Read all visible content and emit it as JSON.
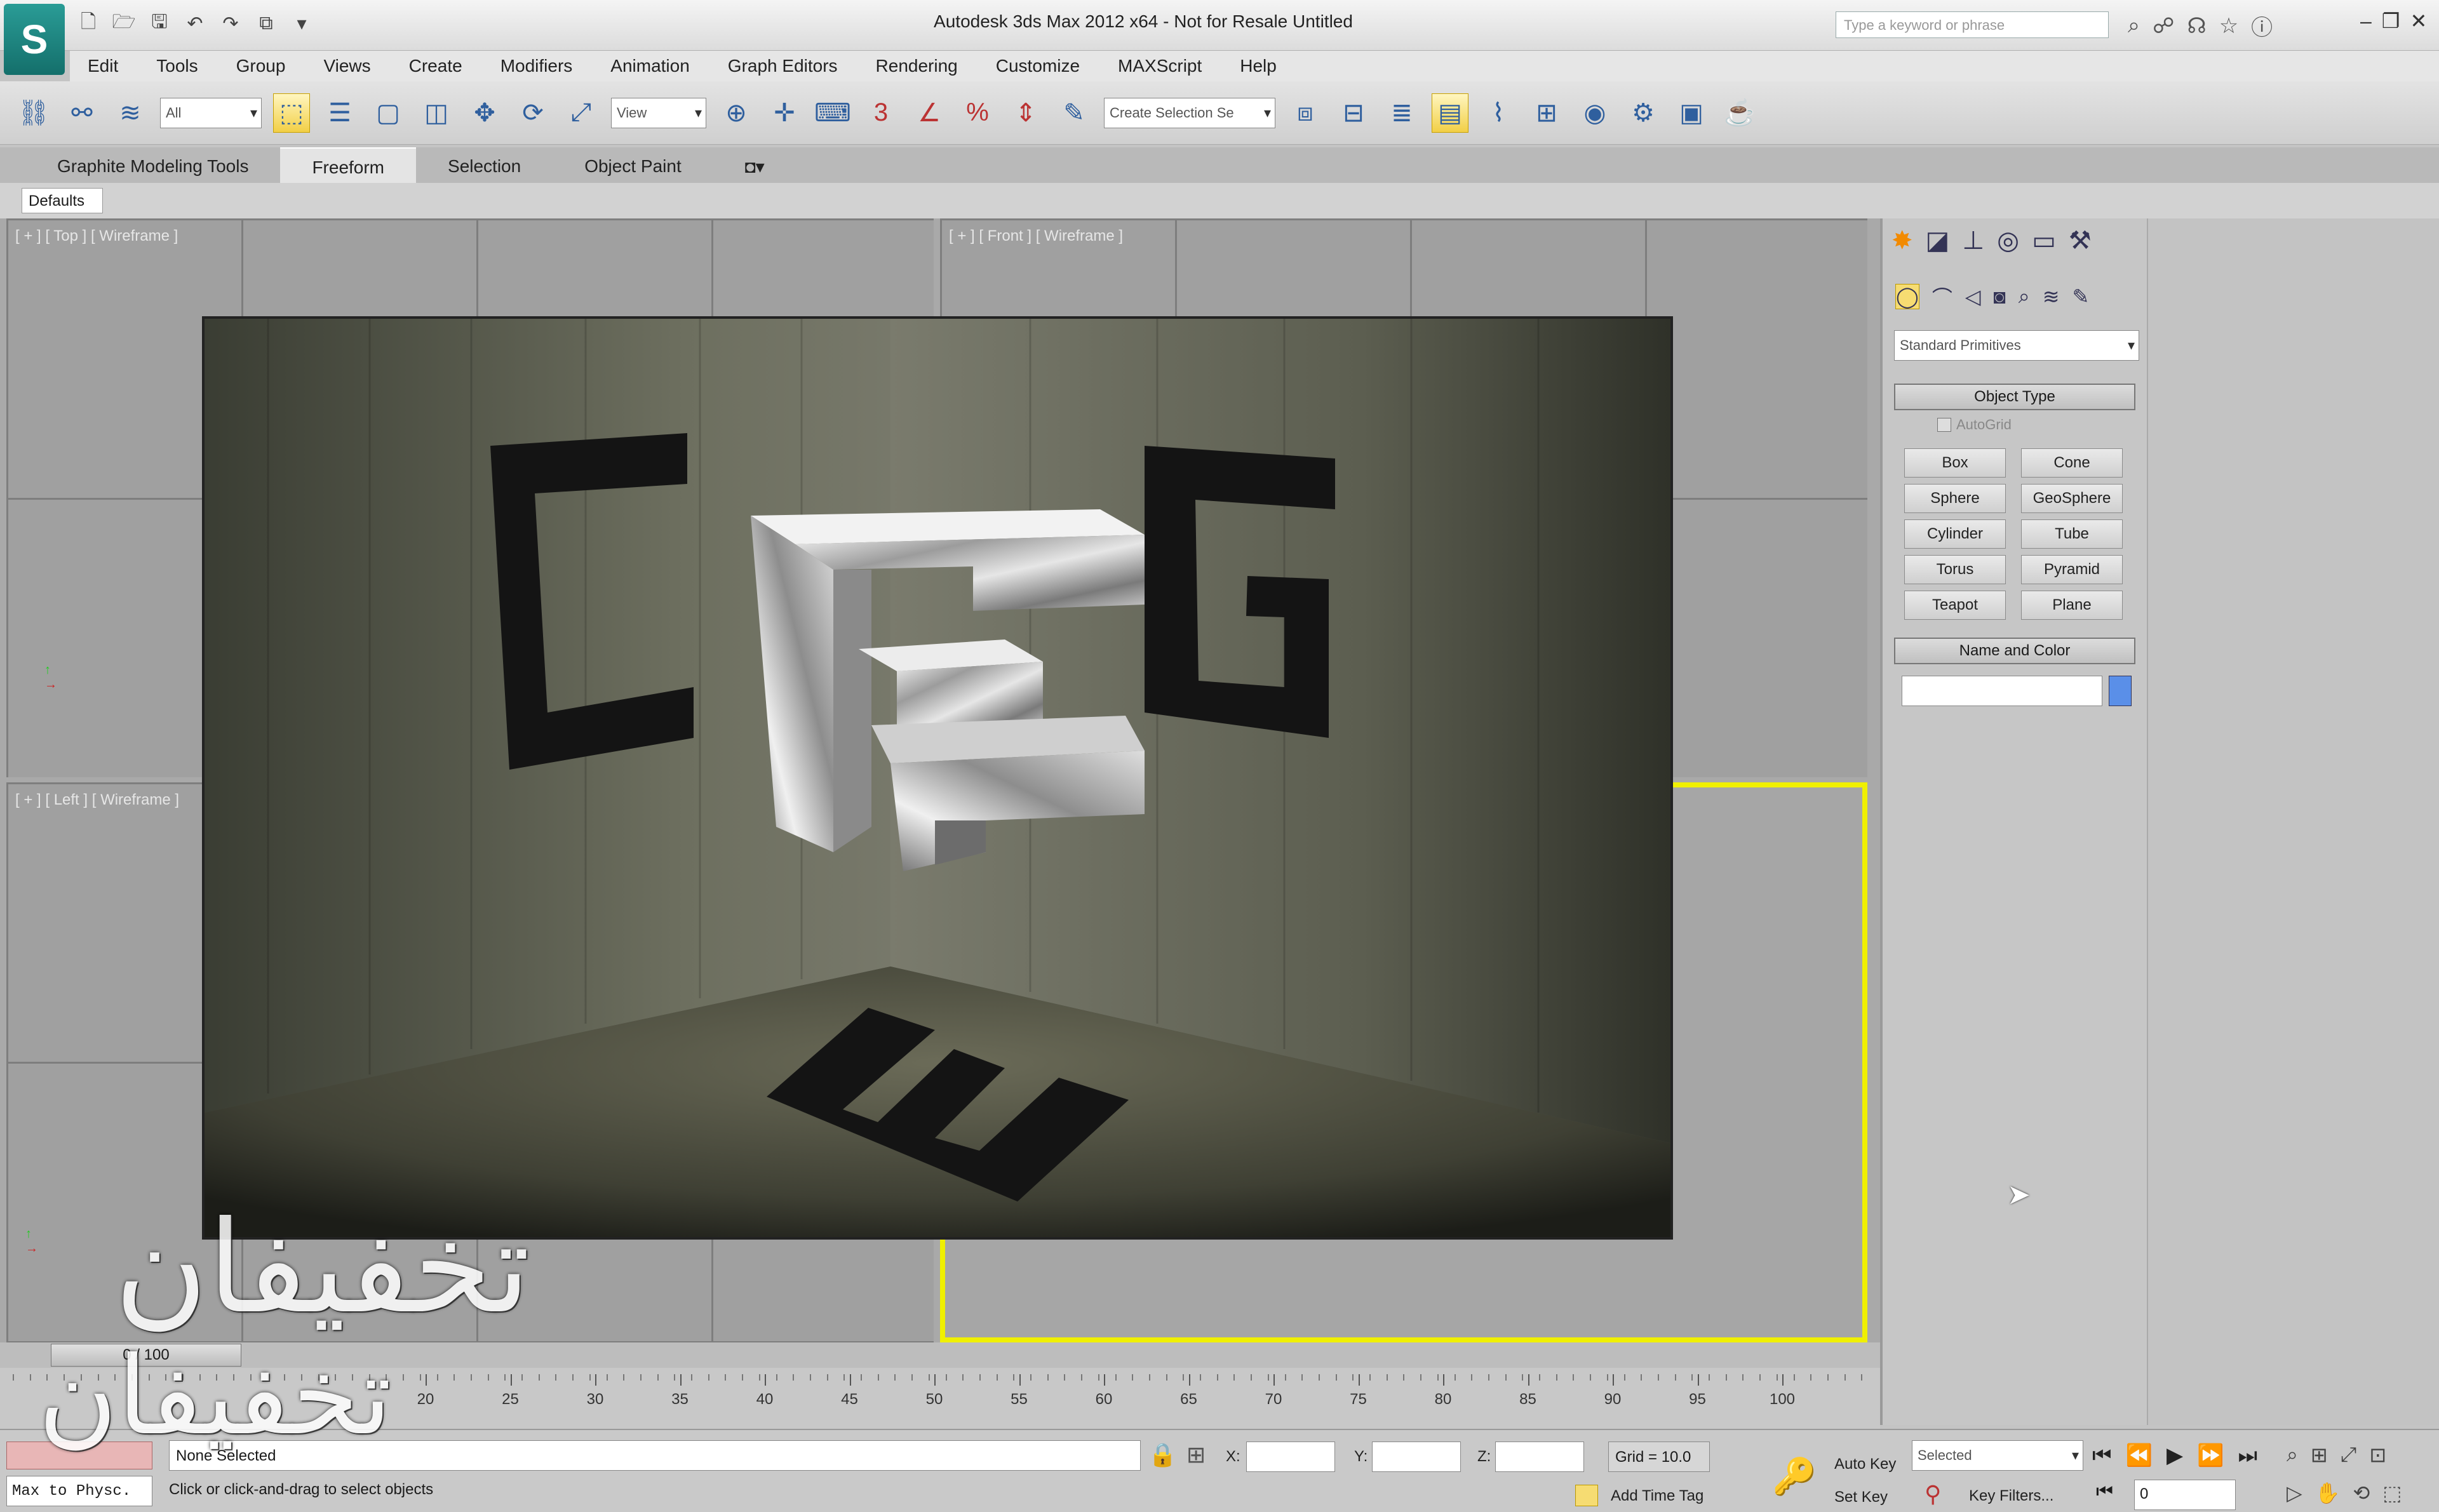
{
  "app": {
    "logo_letter": "S",
    "window_title": "Autodesk 3ds Max 2012 x64  -  Not for Resale    Untitled"
  },
  "titlebar": {
    "search_placeholder": "Type a keyword or phrase"
  },
  "menu": [
    "Edit",
    "Tools",
    "Group",
    "Views",
    "Create",
    "Modifiers",
    "Animation",
    "Graph Editors",
    "Rendering",
    "Customize",
    "MAXScript",
    "Help"
  ],
  "toolbar": {
    "filter_value": "All",
    "view_value": "View",
    "selection_set_placeholder": "Create Selection Se"
  },
  "ribbon": {
    "tabs": [
      "Graphite Modeling Tools",
      "Freeform",
      "Selection",
      "Object Paint"
    ],
    "active_tab": "Freeform",
    "subtab": "Defaults"
  },
  "viewports": {
    "top": "[ + ] [ Top ] [ Wireframe ]",
    "front": "[ + ] [ Front ] [ Wireframe ]",
    "left": "[ + ] [ Left ] [ Wireframe ]"
  },
  "render": {
    "letters": [
      "C",
      "G",
      "E"
    ]
  },
  "command_panel": {
    "category_value": "Standard Primitives",
    "object_type_title": "Object Type",
    "autogrid_label": "AutoGrid",
    "primitives": [
      "Box",
      "Cone",
      "Sphere",
      "GeoSphere",
      "Cylinder",
      "Tube",
      "Torus",
      "Pyramid",
      "Teapot",
      "Plane"
    ],
    "name_color_title": "Name and Color",
    "name_value": ""
  },
  "timeline": {
    "position": "0 / 100",
    "ticks": [
      "20",
      "25",
      "30",
      "35",
      "40",
      "45",
      "50",
      "55",
      "60",
      "65",
      "70",
      "75",
      "80",
      "85",
      "90",
      "95",
      "100"
    ]
  },
  "status": {
    "maxscript": "Max to Physc.",
    "selection": "None Selected",
    "prompt": "Click or click-and-drag to select objects",
    "x_label": "X:",
    "y_label": "Y:",
    "z_label": "Z:",
    "grid": "Grid = 10.0",
    "add_time_tag": "Add Time Tag",
    "auto_key": "Auto Key",
    "set_key": "Set Key",
    "key_mode": "Selected",
    "key_filters": "Key Filters...",
    "frame": "0"
  },
  "watermark": {
    "line1": "تخفيفان",
    "line2": "تخفيفان"
  }
}
